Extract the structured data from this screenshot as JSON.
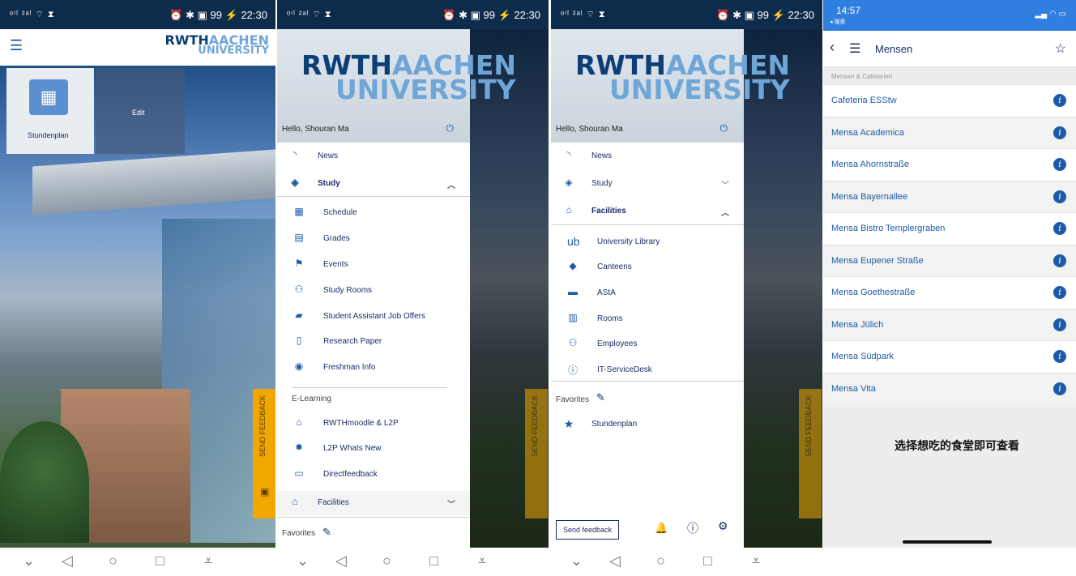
{
  "status": {
    "signal": "ᵒⁱˡ ²ᵃˡ ⌔ ⧗",
    "time": "22:30",
    "right_glyphs": "⏰ ✱ ▣ 99 ⚡"
  },
  "logo": {
    "dark": "RWTH",
    "light": "AACHEN",
    "second": "UNIVERSITY"
  },
  "screen1": {
    "tile_label": "Stundenplan",
    "edit_label": "Edit",
    "feedback_label": "SEND FEEDBACK"
  },
  "drawer1": {
    "hello": "Hello, Shouran Ma",
    "items": {
      "news": "News",
      "study": "Study",
      "schedule": "Schedule",
      "grades": "Grades",
      "events": "Events",
      "study_rooms": "Study Rooms",
      "job_offers": "Student Assistant Job Offers",
      "research_paper": "Research Paper",
      "freshman_info": "Freshman Info",
      "elearning": "E-Learning",
      "moodle": "RWTHmoodle & L2P",
      "l2p_new": "L2P Whats New",
      "directfeedback": "Directfeedback",
      "facilities": "Facilities",
      "favorites": "Favorites"
    }
  },
  "drawer2": {
    "hello": "Hello, Shouran Ma",
    "items": {
      "news": "News",
      "study": "Study",
      "facilities": "Facilities",
      "library": "University Library",
      "canteens": "Canteens",
      "asta": "AStA",
      "rooms": "Rooms",
      "employees": "Employees",
      "servicedesk": "IT-ServiceDesk",
      "favorites": "Favorites",
      "stundenplan": "Stundenplan",
      "send_feedback": "Send feedback"
    }
  },
  "ios": {
    "time": "14:57",
    "back_app": "◂ 搜索",
    "title": "Mensen",
    "section": "Mensen & Cafeterien",
    "rows": [
      "Cafeteria ESStw",
      "Mensa Academica",
      "Mensa Ahornstraße",
      "Mensa Bayernallee",
      "Mensa Bistro Templergraben",
      "Mensa Eupener Straße",
      "Mensa Goethestraße",
      "Mensa Jülich",
      "Mensa Südpark",
      "Mensa Vita"
    ],
    "caption": "选择想吃的食堂即可查看"
  },
  "colors": {
    "navy": "#0d2b4a",
    "accent": "#1e5aa8",
    "feedback": "#f0a800"
  }
}
